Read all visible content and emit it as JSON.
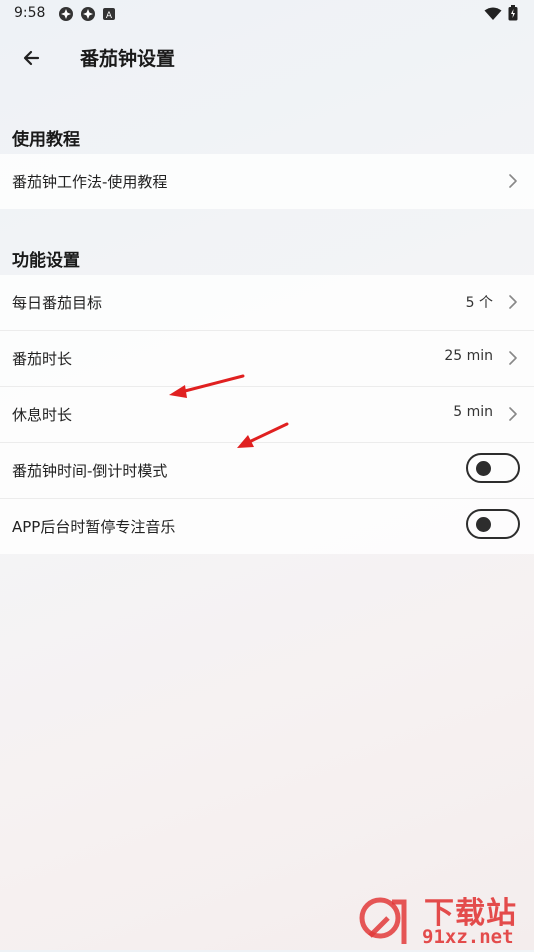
{
  "status_bar": {
    "time": "9:58",
    "notification_icons": [
      "app-icon",
      "app-icon",
      "text-a-icon"
    ],
    "system_icons": [
      "wifi-icon",
      "battery-icon"
    ]
  },
  "app_bar": {
    "back_icon": "arrow-left-icon",
    "title": "番茄钟设置"
  },
  "sections": {
    "tutorial": {
      "title": "使用教程",
      "items": [
        {
          "label": "番茄钟工作法-使用教程"
        }
      ]
    },
    "function": {
      "title": "功能设置",
      "items": [
        {
          "label": "每日番茄目标",
          "value": "5 个"
        },
        {
          "label": "番茄时长",
          "value": "25 min"
        },
        {
          "label": "休息时长",
          "value": "5 min"
        },
        {
          "label": "番茄钟时间-倒计时模式",
          "toggle": "off"
        },
        {
          "label": "APP后台时暂停专注音乐",
          "toggle": "off"
        }
      ]
    }
  },
  "watermark": {
    "text_top": "下载站",
    "text_bottom": "91xz.net",
    "logo_text": "91"
  },
  "colors": {
    "annotation_arrow": "#e02020",
    "watermark_red": "#e23a3a"
  }
}
